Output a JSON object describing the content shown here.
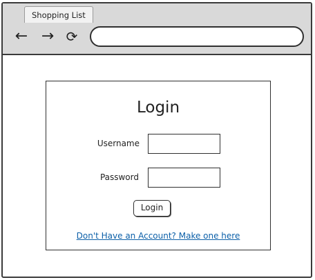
{
  "browser": {
    "tab_title": "Shopping List",
    "back_icon": "←",
    "forward_icon": "→",
    "reload_icon": "⟳",
    "address_value": ""
  },
  "login": {
    "title": "Login",
    "username_label": "Username",
    "username_value": "",
    "password_label": "Password",
    "password_value": "",
    "submit_label": "Login",
    "signup_link": "Don't Have an Account? Make one here"
  },
  "colors": {
    "chrome_background": "#d9d9d9",
    "link": "#0b5fa8"
  }
}
